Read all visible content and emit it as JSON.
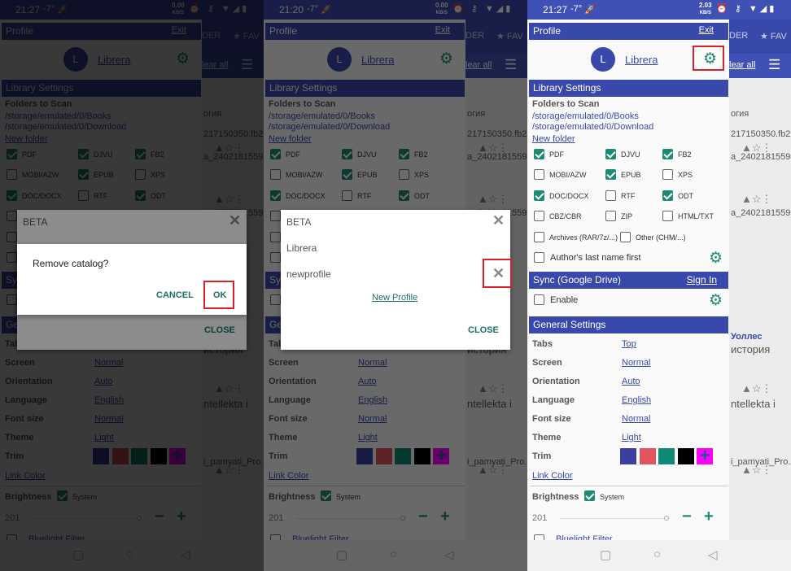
{
  "panels": [
    {
      "status": {
        "time": "21:27",
        "temp": "-7°",
        "speed": "0.00",
        "speed_unit": "KB/S"
      },
      "dimmed": true,
      "dialog": "confirm"
    },
    {
      "status": {
        "time": "21:20",
        "temp": "-7°",
        "speed": "0.00",
        "speed_unit": "KB/S"
      },
      "dimmed": true,
      "dialog": "profiles"
    },
    {
      "status": {
        "time": "21:27",
        "temp": "-7°",
        "speed": "2.03",
        "speed_unit": "KB/S"
      },
      "dimmed": false,
      "dialog": "none"
    }
  ],
  "status_icons": "⏰ ⚷ ▼◢▮",
  "background_app": {
    "tabs": [
      "DER",
      "★ FAV"
    ],
    "clear_all": "lear all",
    "texts": [
      "огия",
      "217150350.fb2",
      "a_2402181559...",
      "a_2402181559...",
      "Уоллес",
      "история",
      "ntellekta i",
      "i_pamyati_Pro..."
    ]
  },
  "drawer": {
    "profile": {
      "title": "Profile",
      "exit": "Exit",
      "avatar_letter": "L",
      "name": "Librera"
    },
    "library": {
      "title": "Library Settings",
      "folders_label": "Folders to Scan",
      "folders": [
        "/storage/emulated/0/Books",
        "/storage/emulated/0/Download"
      ],
      "new_folder": "New folder",
      "formats": [
        {
          "label": "PDF",
          "checked": true
        },
        {
          "label": "DJVU",
          "checked": true
        },
        {
          "label": "FB2",
          "checked": true
        },
        {
          "label": "MOBI/AZW",
          "checked": false
        },
        {
          "label": "EPUB",
          "checked": true
        },
        {
          "label": "XPS",
          "checked": false
        },
        {
          "label": "DOC/DOCX",
          "checked": true
        },
        {
          "label": "RTF",
          "checked": false
        },
        {
          "label": "ODT",
          "checked": true
        },
        {
          "label": "CBZ/CBR",
          "checked": false
        },
        {
          "label": "ZIP",
          "checked": false
        },
        {
          "label": "HTML/TXT",
          "checked": false
        },
        {
          "label": "Archives (RAR/7z/...)",
          "checked": false
        },
        {
          "label": "Other (CHM/...)",
          "checked": false
        }
      ],
      "author_last_name_first": {
        "label": "Author's last name first",
        "checked": false
      }
    },
    "sync": {
      "title": "Sync (Google Drive)",
      "sign_in": "Sign In",
      "enable": {
        "label": "Enable",
        "checked": false
      }
    },
    "general": {
      "title": "General Settings",
      "rows": [
        {
          "label": "Tabs",
          "value": "Top"
        },
        {
          "label": "Screen",
          "value": "Normal"
        },
        {
          "label": "Orientation",
          "value": "Auto"
        },
        {
          "label": "Language",
          "value": "English"
        },
        {
          "label": "Font size",
          "value": "Normal"
        },
        {
          "label": "Theme",
          "value": "Light"
        }
      ],
      "trim_label": "Trim",
      "trim_colors": [
        "#3a3fa0",
        "#e0555e",
        "#0f8a74",
        "#000000",
        "#ff00ff"
      ],
      "link_color": "Link Color",
      "brightness_label": "Brightness",
      "brightness_system": {
        "label": "System",
        "checked": true
      },
      "brightness_value": "201",
      "bluelight": "Bluelight Filter"
    }
  },
  "profiles_dialog": {
    "title": "BETA",
    "profiles": [
      "Librera",
      "newprofile"
    ],
    "new_profile": "New Profile",
    "close": "CLOSE"
  },
  "confirm_dialog": {
    "message": "Remove catalog?",
    "cancel": "CANCEL",
    "ok": "OK"
  },
  "colors": {
    "accent": "#3949ab",
    "teal": "#1d8a73",
    "highlight": "#d9202a"
  }
}
